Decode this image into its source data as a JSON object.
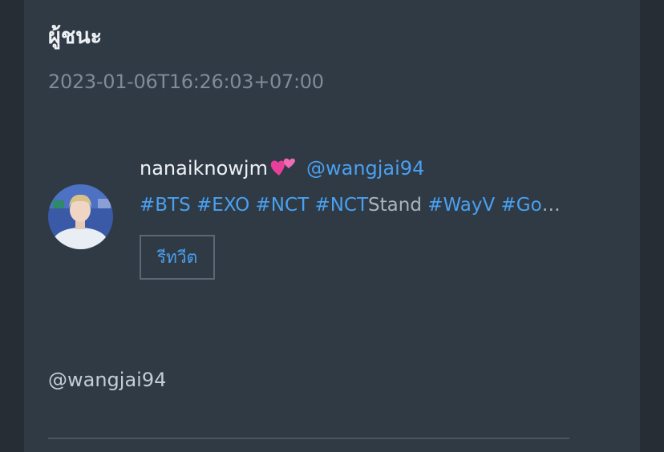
{
  "post": {
    "title": "ผู้ชนะ",
    "timestamp": "2023-01-06T16:26:03+07:00"
  },
  "profile": {
    "display_name": "nanaiknowjm",
    "name_emoji": "two-hearts-icon",
    "handle": "@wangjai94",
    "bio_tags": [
      {
        "text": "#BTS",
        "style": "tag"
      },
      {
        "text": " ",
        "style": "text"
      },
      {
        "text": "#EXO",
        "style": "tag"
      },
      {
        "text": " ",
        "style": "text"
      },
      {
        "text": "#NCT",
        "style": "tag"
      },
      {
        "text": " ",
        "style": "text"
      },
      {
        "text": "#NCT",
        "style": "tag"
      },
      {
        "text": "Stand",
        "style": "text"
      },
      {
        "text": " ",
        "style": "text"
      },
      {
        "text": "#WayV",
        "style": "tag"
      },
      {
        "text": " ",
        "style": "text"
      },
      {
        "text": "#Got…",
        "style": "tag"
      }
    ],
    "retweet_label": "รีทวีต"
  },
  "mention": "@wangjai94",
  "colors": {
    "background": "#262e36",
    "panel": "#2f3a45",
    "accent": "#4aa0f0",
    "muted": "#7f8b97"
  }
}
